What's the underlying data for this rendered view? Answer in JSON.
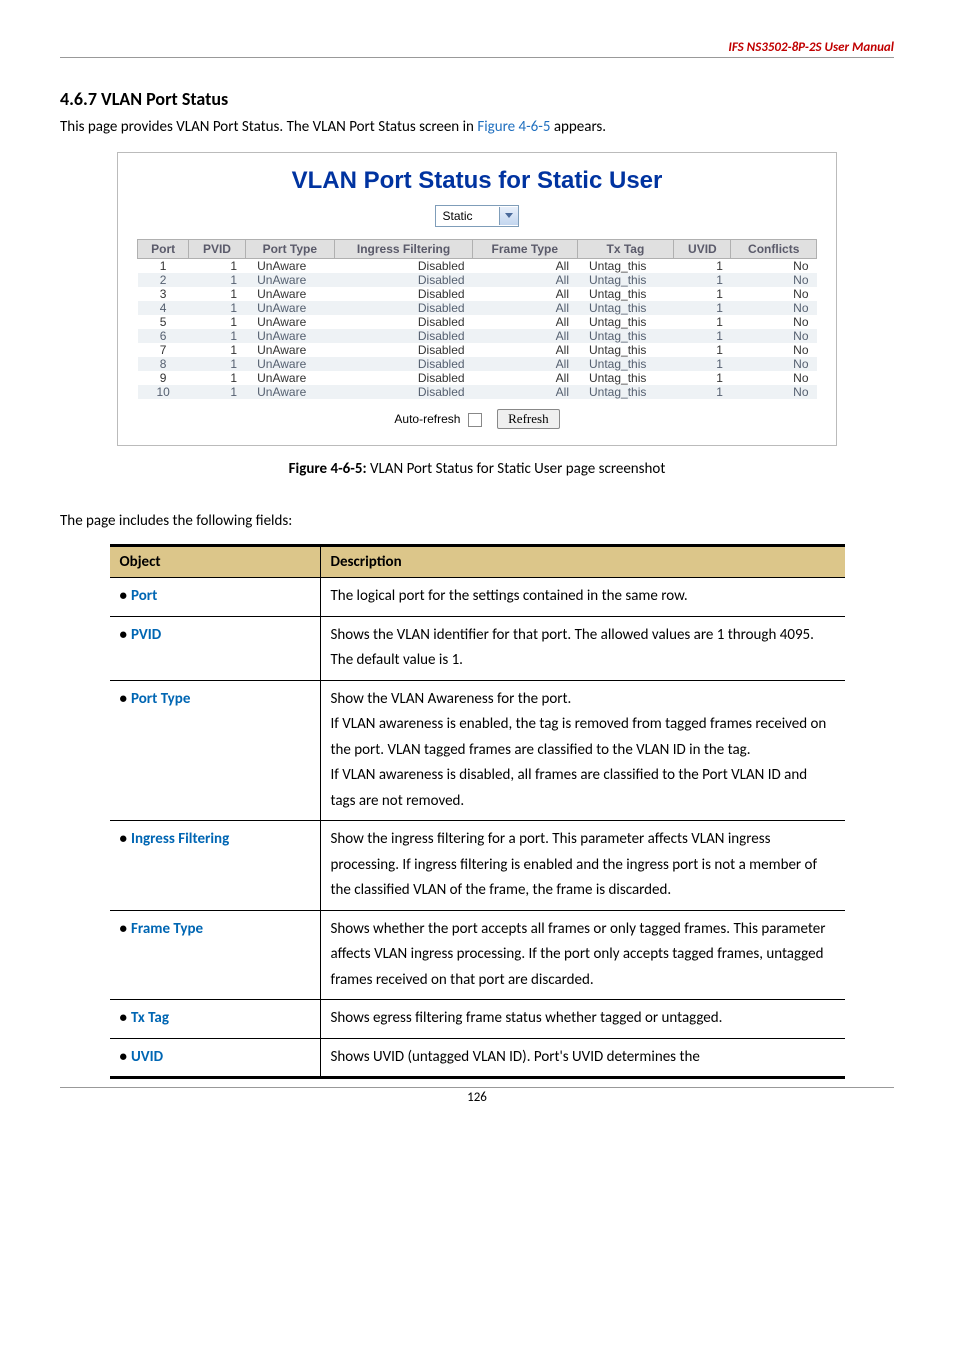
{
  "header": {
    "doc_title": "IFS  NS3502-8P-2S  User Manual"
  },
  "section": {
    "heading": "4.6.7 VLAN Port Status",
    "intro_pre": "This page provides VLAN Port Status. The VLAN Port Status screen in ",
    "intro_ref": "Figure 4-6-5",
    "intro_post": " appears."
  },
  "screenshot": {
    "title": "VLAN Port Status for Static User",
    "select_value": "Static",
    "columns": [
      "Port",
      "PVID",
      "Port Type",
      "Ingress Filtering",
      "Frame Type",
      "Tx Tag",
      "UVID",
      "Conflicts"
    ],
    "rows": [
      {
        "port": "1",
        "pvid": "1",
        "ptype": "UnAware",
        "ifilter": "Disabled",
        "ftype": "All",
        "txtag": "Untag_this",
        "uvid": "1",
        "conf": "No"
      },
      {
        "port": "2",
        "pvid": "1",
        "ptype": "UnAware",
        "ifilter": "Disabled",
        "ftype": "All",
        "txtag": "Untag_this",
        "uvid": "1",
        "conf": "No"
      },
      {
        "port": "3",
        "pvid": "1",
        "ptype": "UnAware",
        "ifilter": "Disabled",
        "ftype": "All",
        "txtag": "Untag_this",
        "uvid": "1",
        "conf": "No"
      },
      {
        "port": "4",
        "pvid": "1",
        "ptype": "UnAware",
        "ifilter": "Disabled",
        "ftype": "All",
        "txtag": "Untag_this",
        "uvid": "1",
        "conf": "No"
      },
      {
        "port": "5",
        "pvid": "1",
        "ptype": "UnAware",
        "ifilter": "Disabled",
        "ftype": "All",
        "txtag": "Untag_this",
        "uvid": "1",
        "conf": "No"
      },
      {
        "port": "6",
        "pvid": "1",
        "ptype": "UnAware",
        "ifilter": "Disabled",
        "ftype": "All",
        "txtag": "Untag_this",
        "uvid": "1",
        "conf": "No"
      },
      {
        "port": "7",
        "pvid": "1",
        "ptype": "UnAware",
        "ifilter": "Disabled",
        "ftype": "All",
        "txtag": "Untag_this",
        "uvid": "1",
        "conf": "No"
      },
      {
        "port": "8",
        "pvid": "1",
        "ptype": "UnAware",
        "ifilter": "Disabled",
        "ftype": "All",
        "txtag": "Untag_this",
        "uvid": "1",
        "conf": "No"
      },
      {
        "port": "9",
        "pvid": "1",
        "ptype": "UnAware",
        "ifilter": "Disabled",
        "ftype": "All",
        "txtag": "Untag_this",
        "uvid": "1",
        "conf": "No"
      },
      {
        "port": "10",
        "pvid": "1",
        "ptype": "UnAware",
        "ifilter": "Disabled",
        "ftype": "All",
        "txtag": "Untag_this",
        "uvid": "1",
        "conf": "No"
      }
    ],
    "auto_refresh_label": "Auto-refresh",
    "refresh_button": "Refresh"
  },
  "caption": {
    "prefix": "Figure 4-6-5:",
    "text": " VLAN Port Status for Static User page screenshot"
  },
  "fields_intro": "The page includes the following fields:",
  "fields_table": {
    "head_object": "Object",
    "head_desc": "Description",
    "rows": [
      {
        "obj": "Port",
        "desc": "The logical port for the settings contained in the same row."
      },
      {
        "obj": "PVID",
        "desc": "Shows the VLAN identifier for that port. The allowed values are 1 through 4095. The default value is 1."
      },
      {
        "obj": "Port Type",
        "desc": "Show the VLAN Awareness for the port.\nIf VLAN awareness is enabled, the tag is removed from tagged frames received on the port. VLAN tagged frames are classified to the VLAN ID in the tag.\nIf VLAN awareness is disabled, all frames are classified to the Port VLAN ID and tags are not removed."
      },
      {
        "obj": "Ingress Filtering",
        "desc": "Show the ingress filtering for a port. This parameter affects VLAN ingress processing. If ingress filtering is enabled and the ingress port is not a member of the classified VLAN of the frame, the frame is discarded."
      },
      {
        "obj": "Frame Type",
        "desc": "Shows whether the port accepts all frames or only tagged frames. This parameter affects VLAN ingress processing. If the port only accepts tagged frames, untagged frames received on that port are discarded."
      },
      {
        "obj": "Tx Tag",
        "desc": "Shows egress filtering frame status whether tagged or untagged."
      },
      {
        "obj": "UVID",
        "desc": "Shows UVID (untagged VLAN ID). Port's UVID determines the"
      }
    ]
  },
  "footer": {
    "page_number": "126"
  }
}
